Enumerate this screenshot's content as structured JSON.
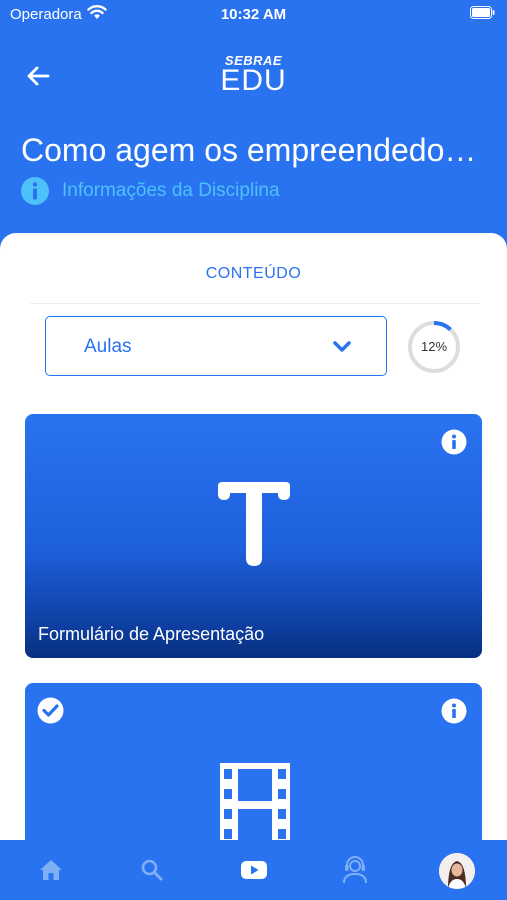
{
  "status_bar": {
    "carrier": "Operadora",
    "time": "10:32 AM"
  },
  "header": {
    "logo_top": "SEBRAE",
    "logo_bottom": "EDU",
    "course_title": "Como agem os empreendedo…",
    "info_link": "Informações da Disciplina"
  },
  "content": {
    "section_label": "CONTEÚDO",
    "select": {
      "value": "Aulas"
    },
    "progress": {
      "label": "12%",
      "value": 0.12
    }
  },
  "cards": [
    {
      "title": "Formulário de Apresentação",
      "icon": "text-icon",
      "completed": false
    },
    {
      "title": "",
      "icon": "film-icon",
      "completed": true
    }
  ],
  "tab_bar": {
    "tabs": [
      "home-icon",
      "search-icon",
      "play-icon",
      "support-icon",
      "profile-avatar"
    ],
    "active": "play-icon"
  },
  "colors": {
    "primary": "#2a73f0",
    "info_link": "#4dc1f9",
    "progress_track": "#dddddd",
    "tab_inactive": "#7fb0f5"
  }
}
